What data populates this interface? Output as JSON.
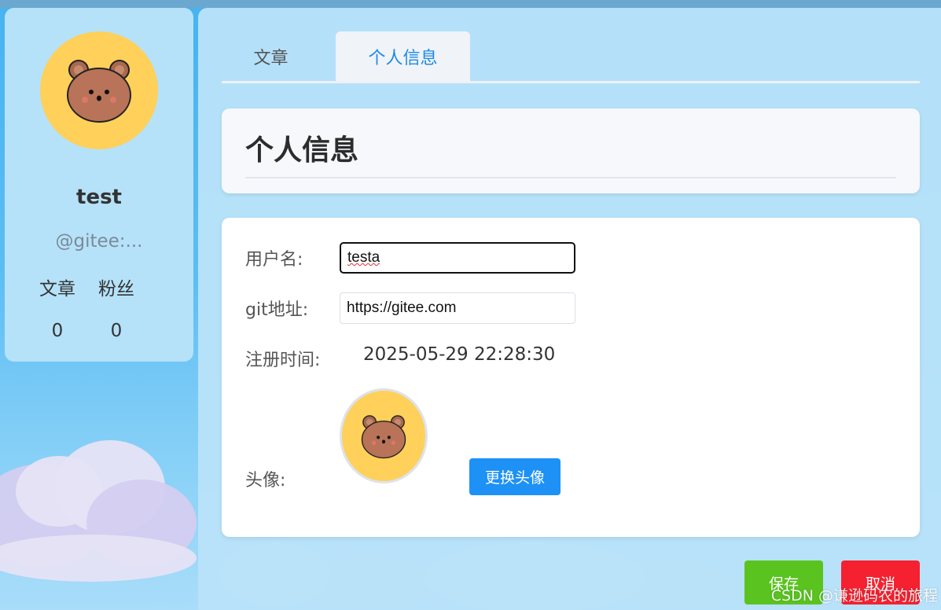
{
  "sidebar": {
    "username": "test",
    "gitee_handle": "@gitee:...",
    "stats": [
      {
        "label": "文章",
        "value": "0"
      },
      {
        "label": "粉丝",
        "value": "0"
      }
    ]
  },
  "tabs": [
    {
      "label": "文章",
      "active": false
    },
    {
      "label": "个人信息",
      "active": true
    }
  ],
  "header": {
    "title": "个人信息"
  },
  "form": {
    "username_label": "用户名:",
    "username_value": "testa",
    "git_label": "git地址:",
    "git_value": "https://gitee.com",
    "register_label": "注册时间:",
    "register_value": "2025-05-29 22:28:30",
    "avatar_label": "头像:",
    "change_avatar_label": "更换头像"
  },
  "actions": {
    "save_label": "保存",
    "cancel_label": "取消"
  },
  "watermark": "CSDN @谦逊码农的旅程",
  "colors": {
    "accent": "#1d91f5",
    "save": "#5ac320",
    "cancel": "#f52130",
    "avatar_bg": "#ffd05a"
  },
  "icons": {
    "avatar": "bear-face-icon"
  }
}
